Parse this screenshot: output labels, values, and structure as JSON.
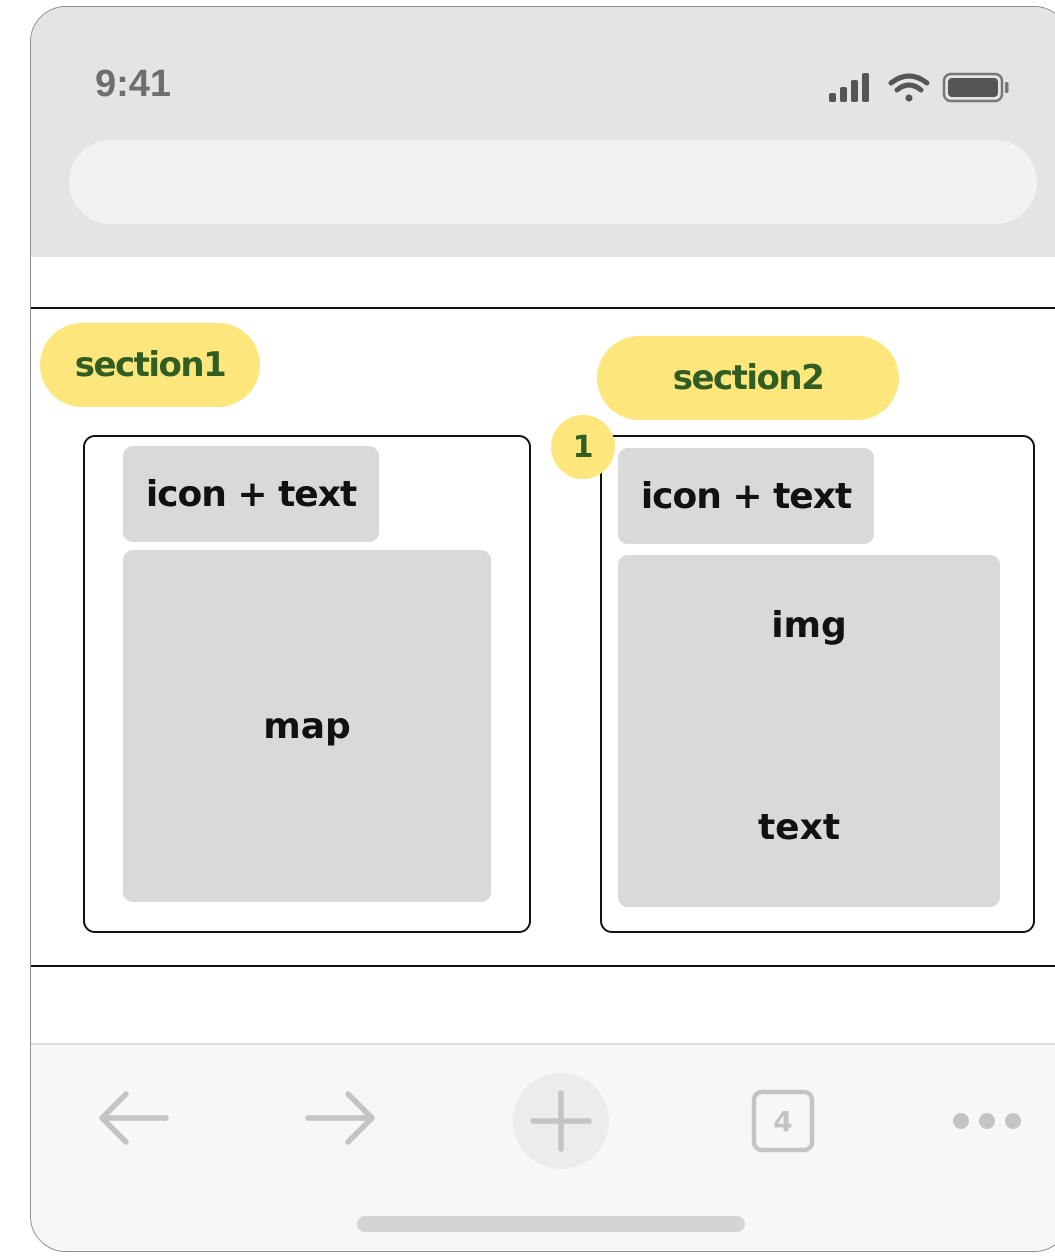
{
  "status_bar": {
    "time": "9:41",
    "icons": [
      "cellular-signal-icon",
      "wifi-icon",
      "battery-icon"
    ]
  },
  "address_bar": {
    "value": ""
  },
  "sections": [
    {
      "label": "section1",
      "card": {
        "header": "icon + text",
        "body": "map"
      }
    },
    {
      "label": "section2",
      "badge": "1",
      "card": {
        "header": "icon + text",
        "image_label": "img",
        "text_label": "text"
      }
    }
  ],
  "toolbar": {
    "tab_count": "4",
    "icons": [
      "back-arrow-icon",
      "forward-arrow-icon",
      "new-tab-plus-icon",
      "tabs-icon",
      "more-icon"
    ]
  },
  "colors": {
    "tag_background": "#fde67c",
    "tag_text": "#2f5d22",
    "placeholder_gray": "#d9d9d9",
    "chrome_gray": "#e4e4e4"
  }
}
